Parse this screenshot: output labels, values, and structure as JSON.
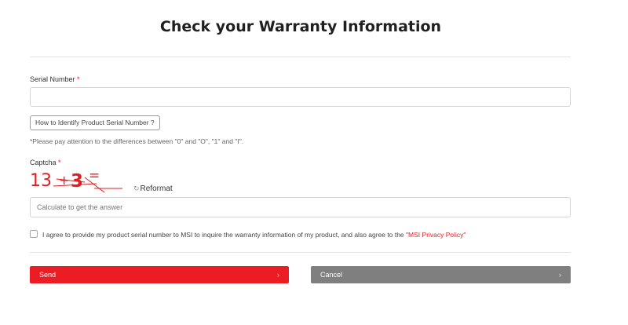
{
  "page": {
    "title": "Check your Warranty Information"
  },
  "serial": {
    "label": "Serial Number",
    "required_mark": "*",
    "value": "",
    "placeholder": "",
    "help_button": "How to Identify Product Serial Number ?",
    "note": "*Please pay attention to the differences between \"0\" and \"O\", \"1\" and \"I\"."
  },
  "captcha": {
    "label": "Captcha",
    "required_mark": "*",
    "image_text": "13 + 3 =",
    "reformat_icon": "refresh-icon",
    "reformat_label": "Reformat",
    "answer_value": "",
    "answer_placeholder": "Calculate to get the answer"
  },
  "agreement": {
    "checked": false,
    "text": "I agree to provide my product serial number to MSI to inquire the warranty information of my product, and also agree to the",
    "link_text": "\"MSI Privacy Policy\""
  },
  "actions": {
    "send_label": "Send",
    "cancel_label": "Cancel",
    "arrow": "›"
  },
  "colors": {
    "accent": "#ec1c24",
    "cancel": "#7f7f7f",
    "required": "#e01e22"
  }
}
